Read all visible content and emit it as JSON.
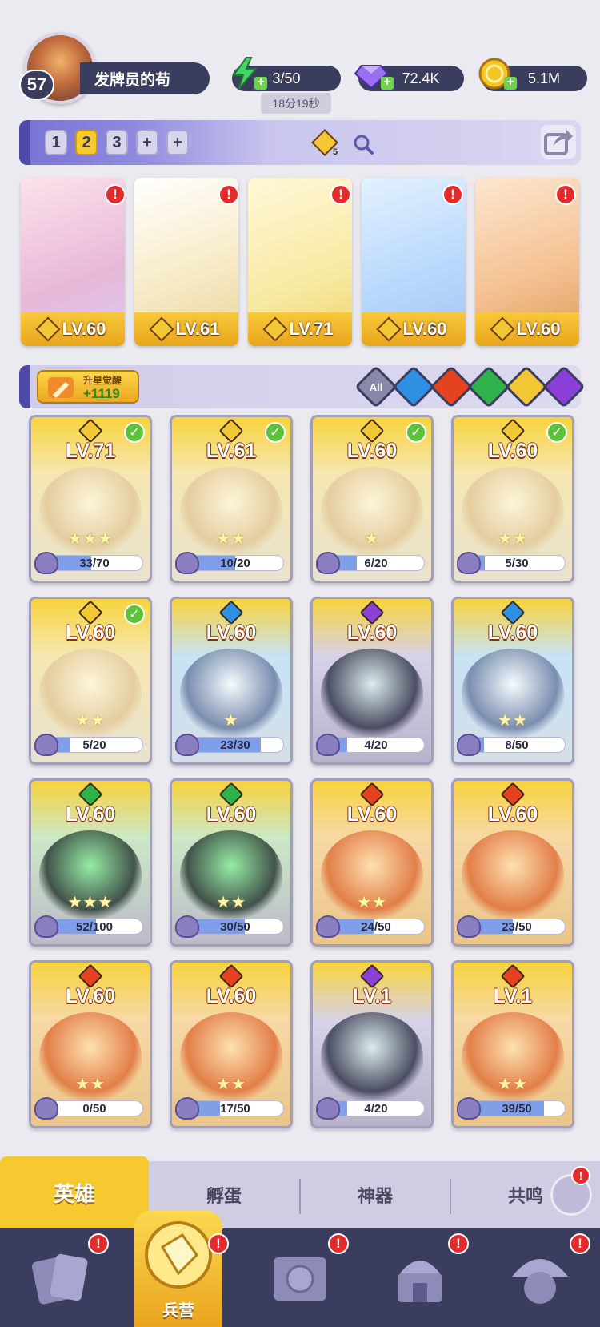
{
  "profile": {
    "level": "57",
    "name": "发牌员的苟"
  },
  "resources": {
    "energy": "3/50",
    "energy_timer": "18分19秒",
    "gems": "72.4K",
    "coins": "5.1M"
  },
  "team_bar": {
    "slots": [
      "1",
      "2",
      "3",
      "+",
      "+"
    ],
    "active_slot": "2",
    "gem_badge": "5"
  },
  "team": [
    {
      "level": "LV.60",
      "alert": "!"
    },
    {
      "level": "LV.61",
      "alert": "!"
    },
    {
      "level": "LV.71",
      "alert": "!"
    },
    {
      "level": "LV.60",
      "alert": "!"
    },
    {
      "level": "LV.60",
      "alert": "!"
    }
  ],
  "star_upgrade": {
    "label": "升星觉醒",
    "value": "+1119"
  },
  "filters": [
    "All"
  ],
  "heroes": [
    {
      "level": "LV.71",
      "progress": "33/70",
      "fill": 0.47,
      "stars": "★★★",
      "element": "gold",
      "checked": true
    },
    {
      "level": "LV.61",
      "progress": "10/20",
      "fill": 0.5,
      "stars": "★★",
      "element": "gold",
      "checked": true
    },
    {
      "level": "LV.60",
      "progress": "6/20",
      "fill": 0.3,
      "stars": "★",
      "element": "gold",
      "checked": true
    },
    {
      "level": "LV.60",
      "progress": "5/30",
      "fill": 0.17,
      "stars": "★★",
      "element": "gold",
      "checked": true
    },
    {
      "level": "LV.60",
      "progress": "5/20",
      "fill": 0.25,
      "stars": "★★",
      "element": "gold",
      "checked": true
    },
    {
      "level": "LV.60",
      "progress": "23/30",
      "fill": 0.77,
      "stars": "★",
      "element": "water",
      "checked": false
    },
    {
      "level": "LV.60",
      "progress": "4/20",
      "fill": 0.2,
      "stars": "",
      "element": "dark",
      "checked": false
    },
    {
      "level": "LV.60",
      "progress": "8/50",
      "fill": 0.16,
      "stars": "★★",
      "element": "water",
      "checked": false
    },
    {
      "level": "LV.60",
      "progress": "52/100",
      "fill": 0.52,
      "stars": "★★★",
      "element": "nature",
      "checked": false
    },
    {
      "level": "LV.60",
      "progress": "30/50",
      "fill": 0.6,
      "stars": "★★",
      "element": "nature",
      "checked": false
    },
    {
      "level": "LV.60",
      "progress": "24/50",
      "fill": 0.48,
      "stars": "★★",
      "element": "fire",
      "checked": false
    },
    {
      "level": "LV.60",
      "progress": "23/50",
      "fill": 0.46,
      "stars": "",
      "element": "fire",
      "checked": false
    },
    {
      "level": "LV.60",
      "progress": "0/50",
      "fill": 0.0,
      "stars": "★★",
      "element": "fire",
      "checked": false
    },
    {
      "level": "LV.60",
      "progress": "17/50",
      "fill": 0.34,
      "stars": "★★",
      "element": "fire",
      "checked": false
    },
    {
      "level": "LV.1",
      "progress": "4/20",
      "fill": 0.2,
      "stars": "",
      "element": "dark",
      "checked": false
    },
    {
      "level": "LV.1",
      "progress": "39/50",
      "fill": 0.78,
      "stars": "★★",
      "element": "fire",
      "checked": false
    }
  ],
  "sub_tabs": [
    "英雄",
    "孵蛋",
    "神器",
    "共鸣"
  ],
  "bottom_nav": {
    "center_label": "兵营"
  },
  "colors": {
    "gold": "#f3c734",
    "water": "#2f8fe3",
    "fire": "#e5421f",
    "nature": "#2fb24a",
    "dark": "#8a3fd6",
    "alert": "#e32b2b",
    "check": "#5cc23a"
  }
}
